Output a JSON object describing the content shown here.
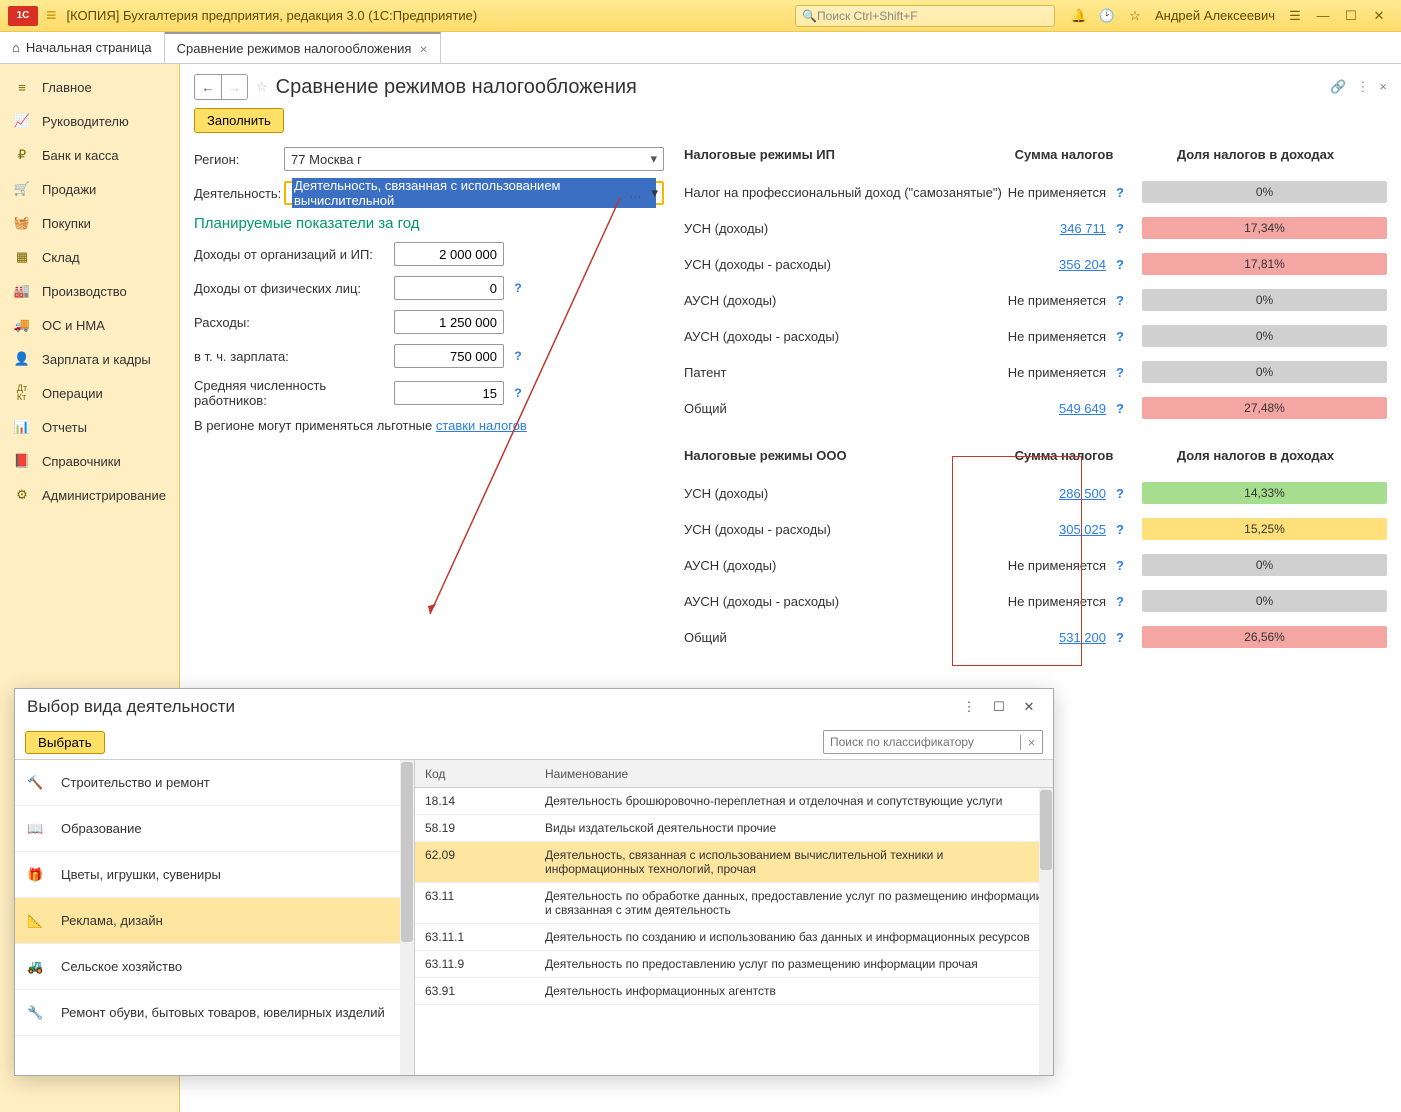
{
  "titlebar": {
    "title": "[КОПИЯ] Бухгалтерия предприятия, редакция 3.0  (1С:Предприятие)",
    "search_placeholder": "Поиск Ctrl+Shift+F",
    "user": "Андрей Алексеевич"
  },
  "tabs": {
    "home": "Начальная страница",
    "active": "Сравнение режимов налогообложения"
  },
  "sidebar": {
    "items": [
      "Главное",
      "Руководителю",
      "Банк и касса",
      "Продажи",
      "Покупки",
      "Склад",
      "Производство",
      "ОС и НМА",
      "Зарплата и кадры",
      "Операции",
      "Отчеты",
      "Справочники",
      "Администрирование"
    ]
  },
  "page": {
    "title": "Сравнение режимов налогообложения",
    "fill": "Заполнить",
    "labels": {
      "region": "Регион:",
      "activity": "Деятельность:",
      "plan_header": "Планируемые показатели за год",
      "income_org": "Доходы от организаций и ИП:",
      "income_phys": "Доходы от физических лиц:",
      "expenses": "Расходы:",
      "salary": "в т. ч. зарплата:",
      "avg_emp": "Средняя численность работников:",
      "note_prefix": "В регионе могут применяться льготные ",
      "note_link": "ставки налогов"
    },
    "values": {
      "region": "77 Москва г",
      "activity": "Деятельность, связанная с использованием вычислительной",
      "income_org": "2 000 000",
      "income_phys": "0",
      "expenses": "1 250 000",
      "salary": "750 000",
      "avg_emp": "15"
    }
  },
  "tax": {
    "headers": {
      "col2": "Сумма налогов",
      "col3": "Доля налогов в доходах"
    },
    "ip_title": "Налоговые режимы ИП",
    "ooo_title": "Налоговые режимы ООО",
    "na": "Не применяется",
    "ip_rows": [
      {
        "name": "Налог на профессиональный доход (\"самозанятые\")",
        "amount": null,
        "share": "0%",
        "color": "grey"
      },
      {
        "name": "УСН (доходы)",
        "amount": "346 711",
        "share": "17,34%",
        "color": "red"
      },
      {
        "name": "УСН (доходы - расходы)",
        "amount": "356 204",
        "share": "17,81%",
        "color": "red"
      },
      {
        "name": "АУСН (доходы)",
        "amount": null,
        "share": "0%",
        "color": "grey"
      },
      {
        "name": "АУСН (доходы - расходы)",
        "amount": null,
        "share": "0%",
        "color": "grey"
      },
      {
        "name": "Патент",
        "amount": null,
        "share": "0%",
        "color": "grey"
      },
      {
        "name": "Общий",
        "amount": "549 649",
        "share": "27,48%",
        "color": "red"
      }
    ],
    "ooo_rows": [
      {
        "name": "УСН (доходы)",
        "amount": "286 500",
        "share": "14,33%",
        "color": "green"
      },
      {
        "name": "УСН (доходы - расходы)",
        "amount": "305 025",
        "share": "15,25%",
        "color": "yellow"
      },
      {
        "name": "АУСН (доходы)",
        "amount": null,
        "share": "0%",
        "color": "grey"
      },
      {
        "name": "АУСН (доходы - расходы)",
        "amount": null,
        "share": "0%",
        "color": "grey"
      },
      {
        "name": "Общий",
        "amount": "531 200",
        "share": "26,56%",
        "color": "red"
      }
    ]
  },
  "dialog": {
    "title": "Выбор вида деятельности",
    "select": "Выбрать",
    "search_placeholder": "Поиск по классификатору",
    "cat_header": {
      "code": "Код",
      "name": "Наименование"
    },
    "categories": [
      "Строительство и ремонт",
      "Образование",
      "Цветы, игрушки, сувениры",
      "Реклама, дизайн",
      "Сельское хозяйство",
      "Ремонт обуви, бытовых товаров, ювелирных изделий"
    ],
    "rows": [
      {
        "code": "18.14",
        "name": "Деятельность брошюровочно-переплетная и отделочная и сопутствующие услуги"
      },
      {
        "code": "58.19",
        "name": "Виды издательской деятельности прочие"
      },
      {
        "code": "62.09",
        "name": "Деятельность, связанная с использованием вычислительной техники и информационных технологий, прочая"
      },
      {
        "code": "63.11",
        "name": "Деятельность по обработке данных, предоставление услуг по размещению информации и связанная с этим деятельность"
      },
      {
        "code": "63.11.1",
        "name": "Деятельность по созданию и использованию баз данных и информационных ресурсов"
      },
      {
        "code": "63.11.9",
        "name": "Деятельность по предоставлению услуг по размещению информации прочая"
      },
      {
        "code": "63.91",
        "name": "Деятельность информационных агентств"
      }
    ]
  }
}
